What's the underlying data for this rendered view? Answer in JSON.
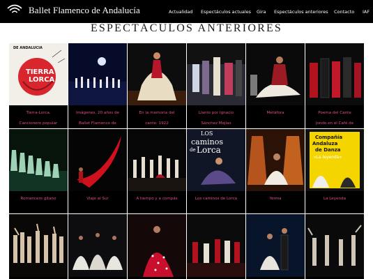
{
  "header": {
    "brand": "Ballet Flamenco de Andalucía",
    "nav": [
      {
        "label": "Actualidad"
      },
      {
        "label": "Espectáculos actuales"
      },
      {
        "label": "Gira"
      },
      {
        "label": "Espectáculos anteriores"
      },
      {
        "label": "Contacto"
      },
      {
        "label": "IAF"
      }
    ]
  },
  "page": {
    "title": "ESPECTÁCULOS ANTERIORES"
  },
  "shows": [
    {
      "caption": "Tierra-Lorca.\nCancionero popular",
      "icon": "tierra-lorca-poster",
      "poster_text": [
        "DE ANDALUCIA",
        "TIERRA",
        "LORCA"
      ]
    },
    {
      "caption": "Imágenes. 20 años de\nBallet Flamenco de",
      "icon": "stage-moon-photo"
    },
    {
      "caption": "En la memoria del\ncante: 1922",
      "icon": "dancer-fringed-shawl-photo"
    },
    {
      "caption": "Llanto por Ignacio\nSánchez Mejías",
      "icon": "group-on-stage-photo"
    },
    {
      "caption": "Metáfora",
      "icon": "dancer-white-dress-photo"
    },
    {
      "caption": "Poema del Cante\njondo en el Café de",
      "icon": "dancers-red-shawls-photo"
    },
    {
      "caption": "Romancero gitano",
      "icon": "green-stage-line-photo"
    },
    {
      "caption": "Viaje al Sur",
      "icon": "red-fabric-dancer-photo"
    },
    {
      "caption": "A tiempo y a compás",
      "icon": "dancers-row-photo"
    },
    {
      "caption": "Los caminos de Lorca",
      "icon": "los-caminos-poster",
      "poster_text": [
        "LOS",
        "caminos",
        "de",
        "Lorca"
      ]
    },
    {
      "caption": "Yerma",
      "icon": "yerma-scene-photo"
    },
    {
      "caption": "La Leyenda",
      "icon": "la-leyenda-poster",
      "poster_text": [
        "Compañía",
        "Andaluza",
        "de Danza",
        "«La leyenda»"
      ]
    },
    {
      "caption": "",
      "icon": "ensemble-pose-photo"
    },
    {
      "caption": "",
      "icon": "dancers-white-skirts-photo"
    },
    {
      "caption": "",
      "icon": "dancer-red-polka-photo"
    },
    {
      "caption": "",
      "icon": "group-red-stage-photo"
    },
    {
      "caption": "",
      "icon": "couple-dance-photo"
    },
    {
      "caption": "",
      "icon": "dancers-dark-stage-photo"
    }
  ],
  "colors": {
    "header_bg": "#000000",
    "caption_pink": "#e04e8a",
    "card_bg": "#000000"
  }
}
